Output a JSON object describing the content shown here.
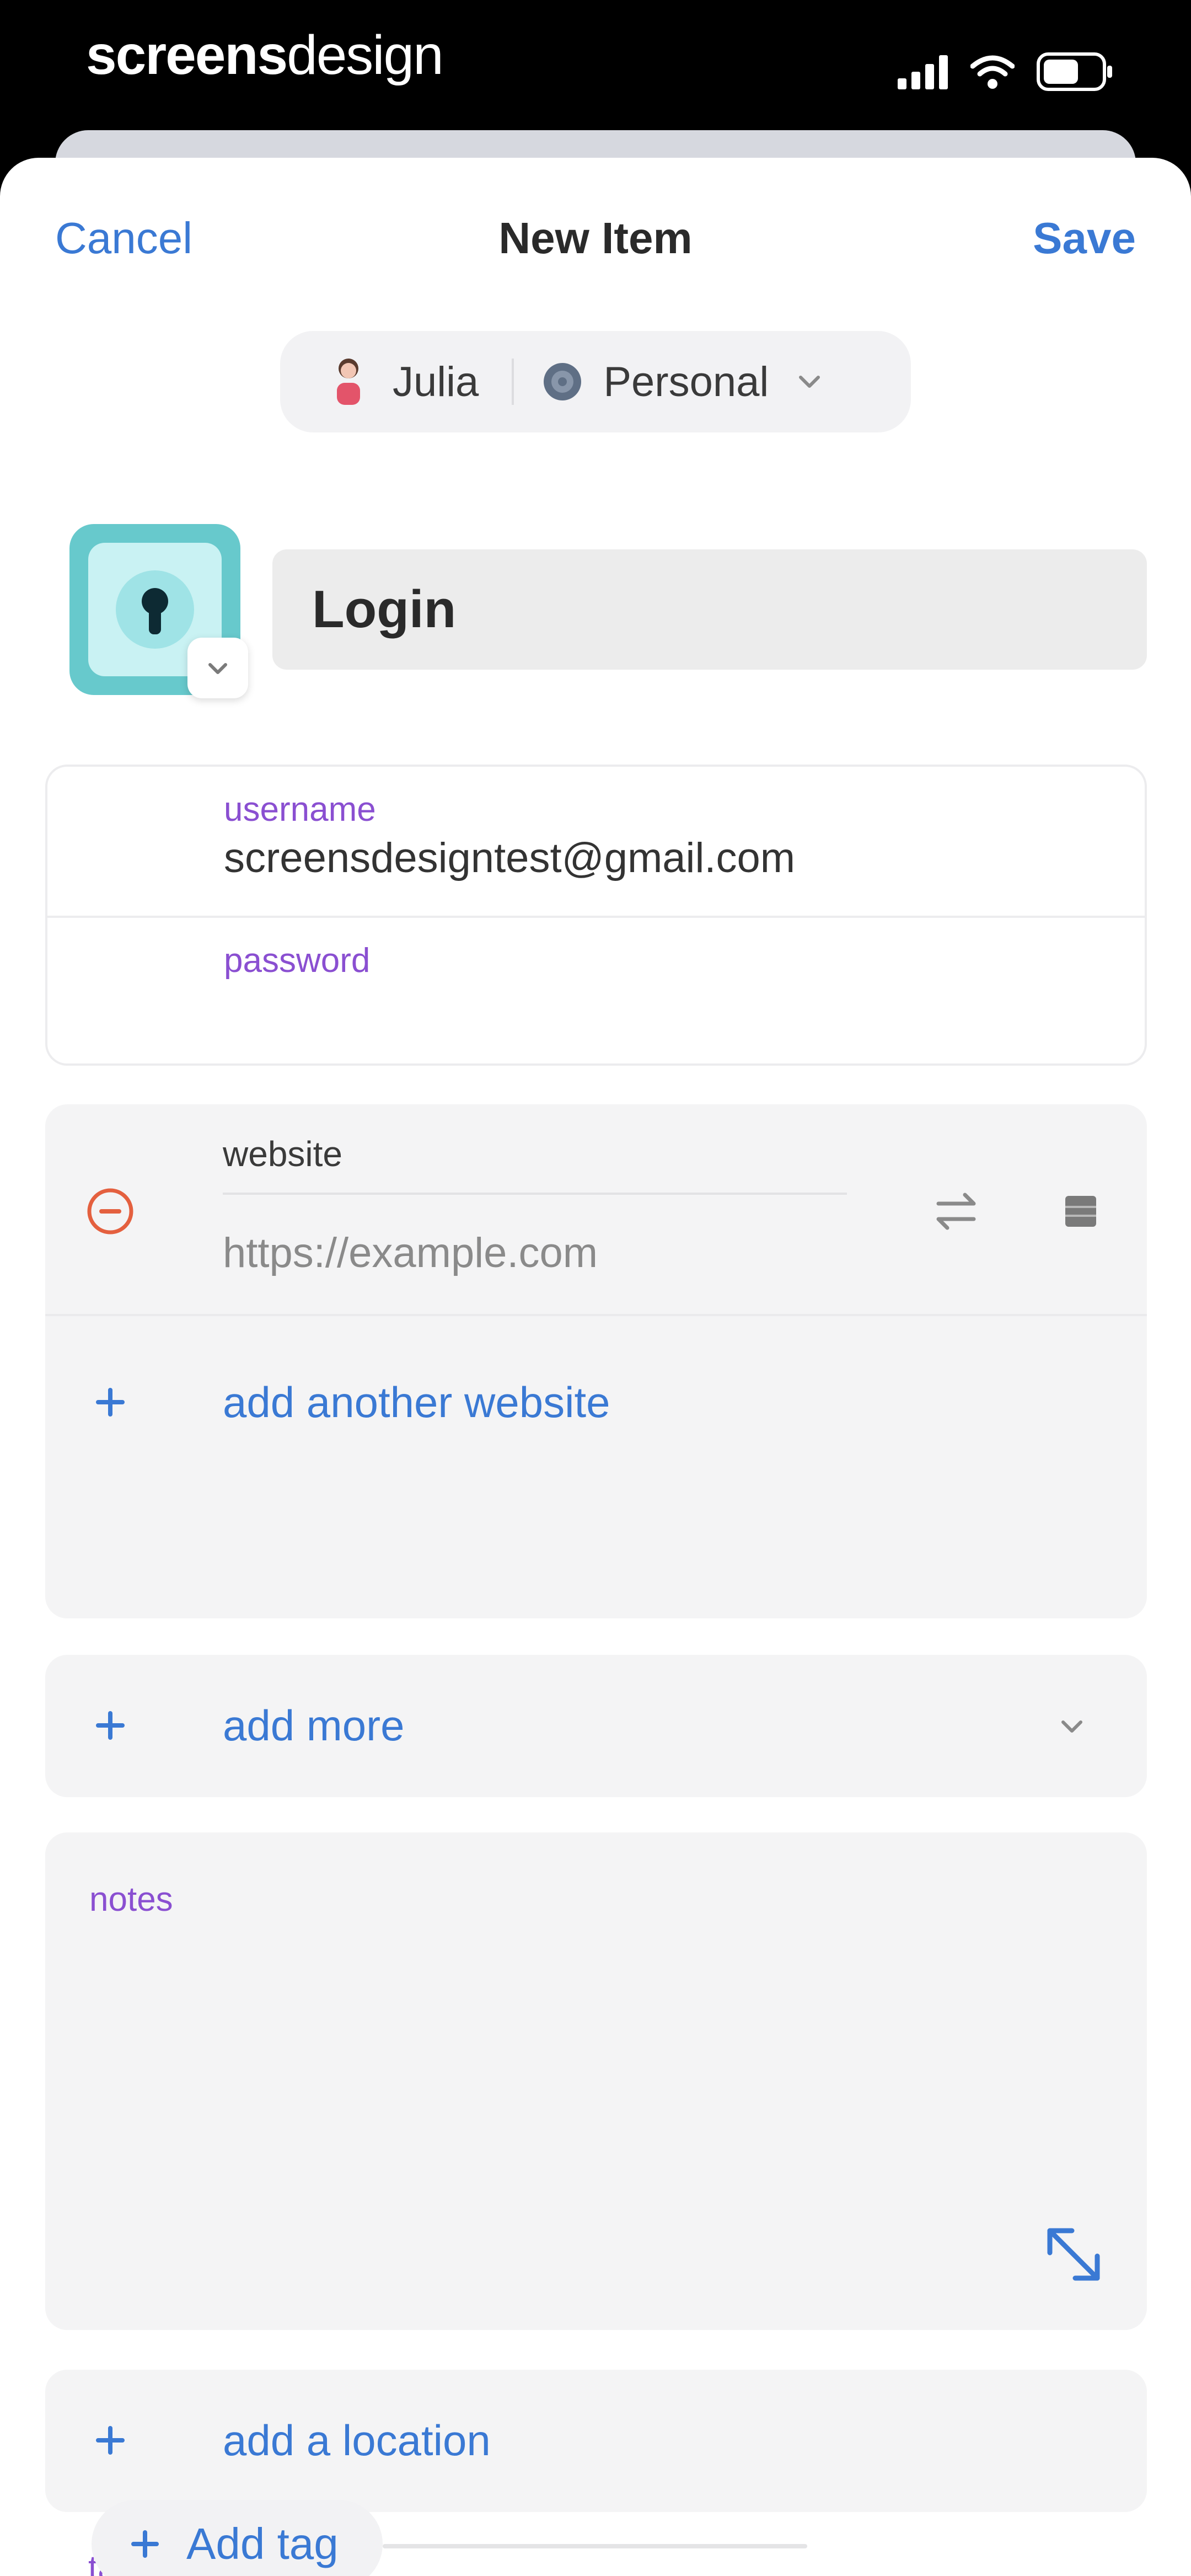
{
  "status_bar": {
    "brand_part1": "screens",
    "brand_part2": "design"
  },
  "nav": {
    "cancel": "Cancel",
    "title": "New Item",
    "save": "Save"
  },
  "account": {
    "user": "Julia",
    "vault": "Personal"
  },
  "item": {
    "title": "Login"
  },
  "credentials": {
    "username_label": "username",
    "username_value": "screensdesigntest@gmail.com",
    "password_label": "password",
    "password_value": ""
  },
  "website": {
    "label": "website",
    "placeholder": "https://example.com",
    "add_another": "add another website"
  },
  "more": {
    "label": "add more"
  },
  "notes": {
    "label": "notes"
  },
  "location": {
    "label": "add a location"
  },
  "tags": {
    "label": "tags",
    "add_label": "Add tag"
  },
  "colors": {
    "accent_blue": "#3a79d4",
    "label_purple": "#8a4fd1",
    "remove_red": "#e4603f",
    "login_icon_teal": "#67c9cc"
  },
  "icons": {
    "cellular": "signal-icon",
    "wifi": "wifi-icon",
    "battery": "battery-icon",
    "remove": "minus-circle-icon",
    "generate": "swap-arrows-icon",
    "reorder": "reorder-handle-icon",
    "expand": "expand-icon",
    "add": "plus-icon"
  }
}
